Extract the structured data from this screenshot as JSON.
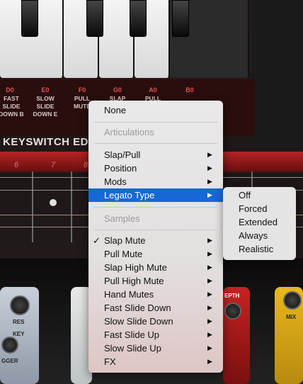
{
  "keyswitch": {
    "title": "KEYSWITCH EDITO",
    "notes": [
      "D0",
      "E0",
      "F0",
      "G0",
      "A0",
      "B0"
    ],
    "subs": [
      [
        "FAST",
        "SLIDE",
        "DOWN B"
      ],
      [
        "SLOW",
        "SLIDE",
        "DOWN E"
      ],
      [
        "PULL",
        "MUTE",
        ""
      ],
      [
        "SLAP",
        "",
        ""
      ],
      [
        "PULL",
        "",
        ""
      ],
      [
        "",
        "",
        ""
      ]
    ]
  },
  "neck": {
    "fret_numbers": [
      "6",
      "7",
      "8"
    ]
  },
  "pedals": {
    "res_label": "RES",
    "key_label": "KEY",
    "gger_label": "GGER",
    "depth_label": "EPTH",
    "mix_label": "MIX"
  },
  "menu": {
    "none": "None",
    "articulations_header": "Articulations",
    "slap_pull": "Slap/Pull",
    "position": "Position",
    "mods": "Mods",
    "legato_type": "Legato Type",
    "samples_header": "Samples",
    "checkmark": "✓",
    "submenu_arrow": "▶",
    "samples": [
      "Slap Mute",
      "Pull Mute",
      "Slap High Mute",
      "Pull High Mute",
      "Hand Mutes",
      "Fast Slide Down",
      "Slow Slide Down",
      "Fast Slide Up",
      "Slow Slide Up",
      "FX"
    ],
    "checked_sample": "Slap Mute"
  },
  "legato_submenu": {
    "items": [
      "Off",
      "Forced",
      "Extended",
      "Always",
      "Realistic"
    ]
  },
  "colors": {
    "highlight": "#1668d6",
    "keyswitch_red": "#e45151"
  }
}
